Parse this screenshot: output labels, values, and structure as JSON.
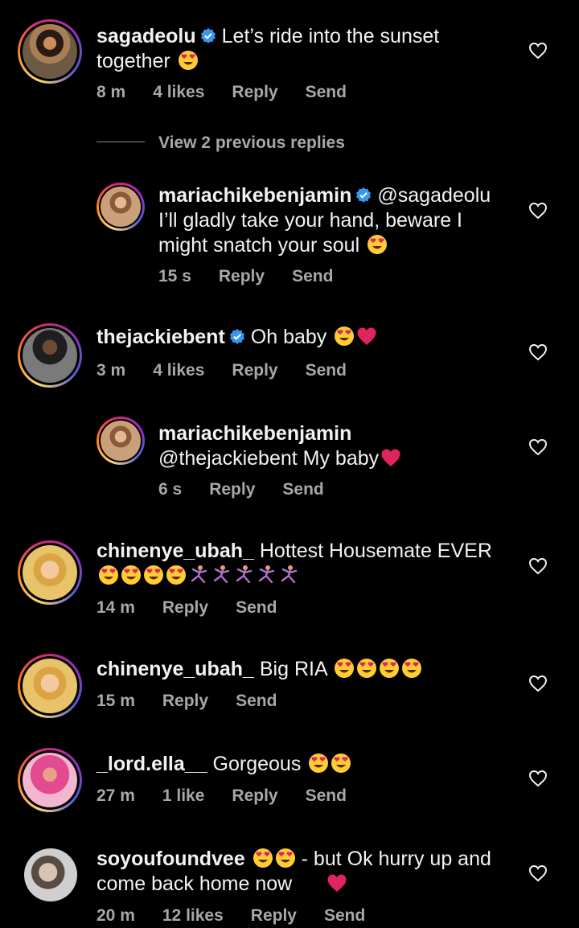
{
  "comments": [
    {
      "user": "sagadeolu",
      "verified": true,
      "text": "Let’s ride into the sunset together",
      "time": "8 m",
      "likes": "4 likes",
      "reply": "Reply",
      "send": "Send"
    },
    {
      "user": "mariachikebenjamin",
      "verified": true,
      "text": "@sagadeolu I’ll gladly take your hand, beware I might snatch your soul",
      "time": "15 s",
      "reply": "Reply",
      "send": "Send"
    },
    {
      "user": "thejackiebent",
      "verified": true,
      "text": "Oh baby",
      "time": "3 m",
      "likes": "4 likes",
      "reply": "Reply",
      "send": "Send"
    },
    {
      "user": "mariachikebenjamin",
      "text": "@thejackiebent My baby",
      "time": "6 s",
      "reply": "Reply",
      "send": "Send"
    },
    {
      "user": "chinenye_ubah_",
      "text": "Hottest Housemate EVER",
      "time": "14 m",
      "reply": "Reply",
      "send": "Send"
    },
    {
      "user": "chinenye_ubah_",
      "text": "Big RIA",
      "time": "15 m",
      "reply": "Reply",
      "send": "Send"
    },
    {
      "user": "_lord.ella__",
      "text": "Gorgeous",
      "time": "27 m",
      "likes": "1 like",
      "reply": "Reply",
      "send": "Send"
    },
    {
      "user": "soyoufoundvee",
      "text_a": "- but Ok hurry up and",
      "text_b": "come back home now",
      "time": "20 m",
      "likes": "12 likes",
      "reply": "Reply",
      "send": "Send"
    }
  ],
  "view_previous": "View 2 previous replies",
  "colors": {
    "background": "#000000",
    "text": "#f2f2f2",
    "meta": "#a8a8a8",
    "verified": "#3797f0",
    "heart_emoji": "#e0245e"
  }
}
